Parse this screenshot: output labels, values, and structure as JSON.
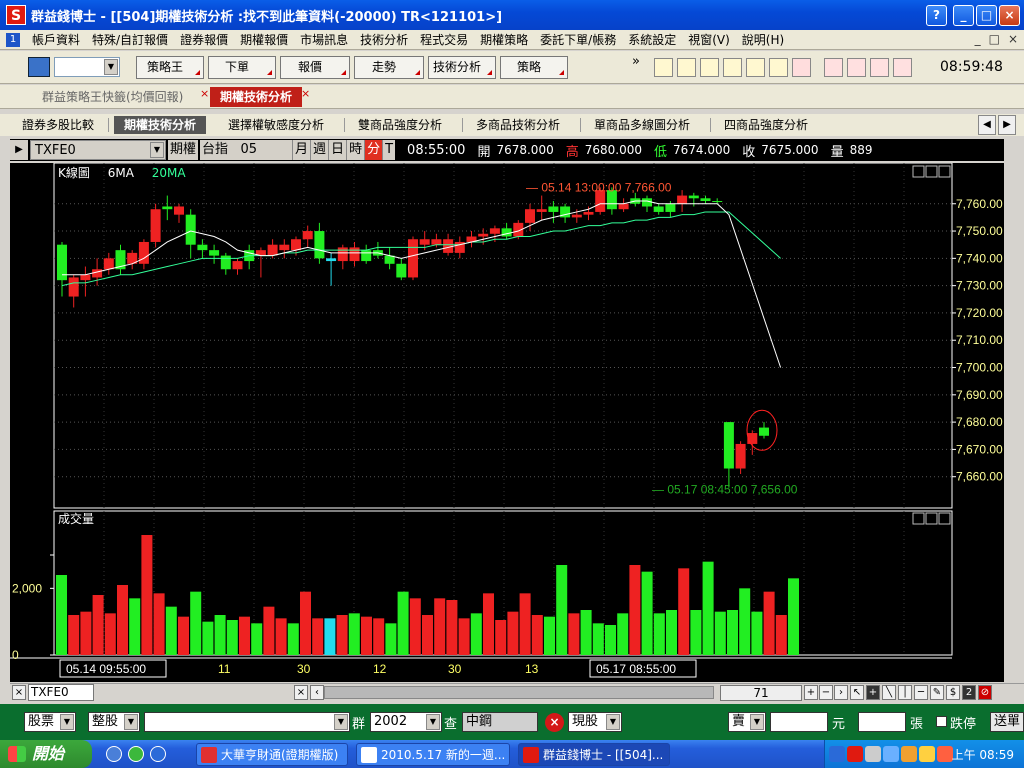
{
  "window": {
    "app_logo": "S",
    "title": "群益錢博士 - [[504]期權技術分析 :找不到此筆資料(-20000) TR<121101>]",
    "help_btn": "?",
    "min_btn": "_",
    "max_btn": "□",
    "close_btn": "×"
  },
  "menu": {
    "items": [
      "帳戶資料",
      "特殊/自訂報價",
      "證券報價",
      "期權報價",
      "市場訊息",
      "技術分析",
      "程式交易",
      "期權策略",
      "委託下單/帳務",
      "系統設定",
      "視窗(V)",
      "說明(H)"
    ],
    "mdi_controls": [
      "_",
      "□",
      "×"
    ]
  },
  "toolbar": {
    "buttons": [
      "策略王",
      "下單",
      "報價",
      "走勢",
      "技術分析",
      "策略"
    ],
    "overflow": "»",
    "clock": "08:59:48"
  },
  "tabs": {
    "items": [
      {
        "label": "群益策略王快籤(均價回報)"
      },
      {
        "label": "期權技術分析"
      }
    ],
    "close": "×"
  },
  "subtabs": {
    "items": [
      "證券多股比較",
      "期權技術分析",
      "選擇權敏感度分析",
      "雙商品強度分析",
      "多商品技術分析",
      "單商品多線圖分析",
      "四商品強度分析"
    ],
    "prev": "◀",
    "next": "▶"
  },
  "quote": {
    "play": "▶",
    "symbol": "TXFE0",
    "market": "期權",
    "product": "台指",
    "month": "05",
    "periods": [
      "月",
      "週",
      "日",
      "時",
      "分",
      "T"
    ],
    "time": "08:55:00",
    "open_label": "開",
    "open": "7678.000",
    "high_label": "高",
    "high": "7680.000",
    "low_label": "低",
    "low": "7674.000",
    "close_label": "收",
    "close": "7675.000",
    "volume_label": "量",
    "volume": "889",
    "colors": {
      "high": "#ff3333",
      "low": "#33ff33"
    }
  },
  "chart_data": [
    {
      "type": "candlestick",
      "title": "K線圖",
      "legend": [
        {
          "name": "6MA",
          "color": "#ffffff"
        },
        {
          "name": "20MA",
          "color": "#33ff99"
        }
      ],
      "ylim": [
        7650,
        7772
      ],
      "y_ticks": [
        "7,760.00",
        "7,750.00",
        "7,740.00",
        "7,730.00",
        "7,720.00",
        "7,710.00",
        "7,700.00",
        "7,690.00",
        "7,680.00",
        "7,670.00",
        "7,660.00"
      ],
      "annotation_high": "05.14 13:00:00  7,766.00",
      "annotation_low": "05.17 08:45:00  7,656.00",
      "x_ticks": [
        "05.14 09:55:00",
        "11",
        "30",
        "12",
        "30",
        "13",
        "05.17 08:55:00"
      ],
      "candles": [
        {
          "o": 7732,
          "h": 7746,
          "l": 7726,
          "c": 7745,
          "col": "g"
        },
        {
          "o": 7733,
          "h": 7734,
          "l": 7722,
          "c": 7726,
          "col": "r"
        },
        {
          "o": 7734,
          "h": 7737,
          "l": 7726,
          "c": 7732,
          "col": "r"
        },
        {
          "o": 7736,
          "h": 7740,
          "l": 7730,
          "c": 7733,
          "col": "r"
        },
        {
          "o": 7740,
          "h": 7742,
          "l": 7734,
          "c": 7736,
          "col": "r"
        },
        {
          "o": 7736,
          "h": 7745,
          "l": 7734,
          "c": 7743,
          "col": "g"
        },
        {
          "o": 7742,
          "h": 7743,
          "l": 7736,
          "c": 7738,
          "col": "r"
        },
        {
          "o": 7738,
          "h": 7747,
          "l": 7736,
          "c": 7746,
          "col": "r"
        },
        {
          "o": 7746,
          "h": 7760,
          "l": 7744,
          "c": 7758,
          "col": "r"
        },
        {
          "o": 7758,
          "h": 7763,
          "l": 7754,
          "c": 7759,
          "col": "g"
        },
        {
          "o": 7759,
          "h": 7760,
          "l": 7753,
          "c": 7756,
          "col": "r"
        },
        {
          "o": 7756,
          "h": 7758,
          "l": 7740,
          "c": 7745,
          "col": "g"
        },
        {
          "o": 7745,
          "h": 7747,
          "l": 7740,
          "c": 7743,
          "col": "g"
        },
        {
          "o": 7743,
          "h": 7745,
          "l": 7738,
          "c": 7741,
          "col": "g"
        },
        {
          "o": 7741,
          "h": 7742,
          "l": 7734,
          "c": 7736,
          "col": "g"
        },
        {
          "o": 7736,
          "h": 7740,
          "l": 7734,
          "c": 7739,
          "col": "r"
        },
        {
          "o": 7739,
          "h": 7745,
          "l": 7736,
          "c": 7743,
          "col": "g"
        },
        {
          "o": 7743,
          "h": 7744,
          "l": 7733,
          "c": 7741,
          "col": "r"
        },
        {
          "o": 7741,
          "h": 7747,
          "l": 7740,
          "c": 7745,
          "col": "r"
        },
        {
          "o": 7745,
          "h": 7747,
          "l": 7740,
          "c": 7743,
          "col": "r"
        },
        {
          "o": 7743,
          "h": 7748,
          "l": 7741,
          "c": 7747,
          "col": "r"
        },
        {
          "o": 7747,
          "h": 7752,
          "l": 7744,
          "c": 7750,
          "col": "r"
        },
        {
          "o": 7750,
          "h": 7753,
          "l": 7738,
          "c": 7740,
          "col": "g"
        },
        {
          "o": 7740,
          "h": 7742,
          "l": 7730,
          "c": 7739,
          "col": "c"
        },
        {
          "o": 7739,
          "h": 7745,
          "l": 7736,
          "c": 7744,
          "col": "r"
        },
        {
          "o": 7744,
          "h": 7746,
          "l": 7737,
          "c": 7739,
          "col": "r"
        },
        {
          "o": 7739,
          "h": 7745,
          "l": 7738,
          "c": 7743,
          "col": "g"
        },
        {
          "o": 7743,
          "h": 7746,
          "l": 7740,
          "c": 7741,
          "col": "g"
        },
        {
          "o": 7741,
          "h": 7744,
          "l": 7736,
          "c": 7738,
          "col": "g"
        },
        {
          "o": 7738,
          "h": 7740,
          "l": 7732,
          "c": 7733,
          "col": "g"
        },
        {
          "o": 7733,
          "h": 7748,
          "l": 7732,
          "c": 7747,
          "col": "r"
        },
        {
          "o": 7747,
          "h": 7750,
          "l": 7743,
          "c": 7745,
          "col": "r"
        },
        {
          "o": 7745,
          "h": 7749,
          "l": 7744,
          "c": 7747,
          "col": "r"
        },
        {
          "o": 7747,
          "h": 7749,
          "l": 7741,
          "c": 7742,
          "col": "r"
        },
        {
          "o": 7742,
          "h": 7748,
          "l": 7740,
          "c": 7746,
          "col": "r"
        },
        {
          "o": 7746,
          "h": 7750,
          "l": 7744,
          "c": 7748,
          "col": "r"
        },
        {
          "o": 7748,
          "h": 7751,
          "l": 7745,
          "c": 7749,
          "col": "r"
        },
        {
          "o": 7749,
          "h": 7752,
          "l": 7746,
          "c": 7751,
          "col": "r"
        },
        {
          "o": 7751,
          "h": 7753,
          "l": 7747,
          "c": 7748,
          "col": "g"
        },
        {
          "o": 7748,
          "h": 7754,
          "l": 7747,
          "c": 7753,
          "col": "r"
        },
        {
          "o": 7753,
          "h": 7760,
          "l": 7750,
          "c": 7758,
          "col": "r"
        },
        {
          "o": 7758,
          "h": 7763,
          "l": 7754,
          "c": 7757,
          "col": "r"
        },
        {
          "o": 7757,
          "h": 7761,
          "l": 7753,
          "c": 7759,
          "col": "g"
        },
        {
          "o": 7759,
          "h": 7760,
          "l": 7753,
          "c": 7755,
          "col": "g"
        },
        {
          "o": 7755,
          "h": 7758,
          "l": 7753,
          "c": 7756,
          "col": "r"
        },
        {
          "o": 7756,
          "h": 7759,
          "l": 7754,
          "c": 7757,
          "col": "r"
        },
        {
          "o": 7757,
          "h": 7766,
          "l": 7756,
          "c": 7765,
          "col": "r"
        },
        {
          "o": 7765,
          "h": 7766,
          "l": 7756,
          "c": 7758,
          "col": "g"
        },
        {
          "o": 7758,
          "h": 7762,
          "l": 7757,
          "c": 7760,
          "col": "r"
        },
        {
          "o": 7760,
          "h": 7764,
          "l": 7759,
          "c": 7762,
          "col": "g"
        },
        {
          "o": 7762,
          "h": 7763,
          "l": 7757,
          "c": 7759,
          "col": "g"
        },
        {
          "o": 7759,
          "h": 7760,
          "l": 7756,
          "c": 7757,
          "col": "g"
        },
        {
          "o": 7757,
          "h": 7761,
          "l": 7755,
          "c": 7760,
          "col": "g"
        },
        {
          "o": 7760,
          "h": 7765,
          "l": 7757,
          "c": 7763,
          "col": "r"
        },
        {
          "o": 7763,
          "h": 7764,
          "l": 7759,
          "c": 7762,
          "col": "g"
        },
        {
          "o": 7762,
          "h": 7763,
          "l": 7760,
          "c": 7761,
          "col": "g"
        },
        {
          "o": 7761,
          "h": 7762,
          "l": 7760,
          "c": 7761,
          "col": "g"
        },
        {
          "o": 7680,
          "h": 7680,
          "l": 7656,
          "c": 7663,
          "col": "g"
        },
        {
          "o": 7663,
          "h": 7673,
          "l": 7661,
          "c": 7672,
          "col": "r"
        },
        {
          "o": 7672,
          "h": 7677,
          "l": 7668,
          "c": 7676,
          "col": "r"
        },
        {
          "o": 7675,
          "h": 7680,
          "l": 7674,
          "c": 7678,
          "col": "g"
        }
      ],
      "ma6": [
        7734,
        7734,
        7734,
        7735,
        7736,
        7737,
        7738,
        7740,
        7743,
        7746,
        7748,
        7750,
        7749,
        7748,
        7746,
        7743,
        7742,
        7741,
        7741,
        7742,
        7743,
        7744,
        7743,
        7742,
        7742,
        7742,
        7742,
        7742,
        7741,
        7740,
        7741,
        7742,
        7743,
        7744,
        7745,
        7746,
        7747,
        7748,
        7749,
        7750,
        7752,
        7754,
        7755,
        7756,
        7757,
        7758,
        7760,
        7760,
        7760,
        7761,
        7761,
        7760,
        7760,
        7760,
        7760,
        7760,
        7760,
        7756,
        7700
      ],
      "ma20": [
        7730,
        7731,
        7731,
        7732,
        7733,
        7734,
        7734,
        7735,
        7736,
        7737,
        7738,
        7739,
        7740,
        7740,
        7740,
        7740,
        7741,
        7741,
        7741,
        7742,
        7742,
        7743,
        7743,
        7743,
        7743,
        7743,
        7743,
        7744,
        7744,
        7744,
        7744,
        7744,
        7745,
        7745,
        7745,
        7746,
        7746,
        7747,
        7747,
        7748,
        7748,
        7749,
        7750,
        7750,
        7751,
        7752,
        7752,
        7753,
        7753,
        7754,
        7754,
        7755,
        7755,
        7756,
        7756,
        7757,
        7757,
        7757,
        7740
      ]
    },
    {
      "type": "bar",
      "title": "成交量",
      "y_ticks": [
        "2,000",
        "0"
      ],
      "ylim": [
        0,
        4200
      ],
      "values": [
        2400,
        1200,
        1300,
        1800,
        1250,
        2100,
        1700,
        3600,
        1850,
        1450,
        1150,
        1900,
        1000,
        1200,
        1050,
        1150,
        950,
        1450,
        1100,
        950,
        1900,
        1100,
        1100,
        1200,
        1250,
        1150,
        1100,
        950,
        1900,
        1700,
        1200,
        1700,
        1650,
        1100,
        1250,
        1850,
        1050,
        1300,
        1850,
        1200,
        1150,
        2700,
        1250,
        1350,
        950,
        900,
        1250,
        2700,
        2500,
        1250,
        1350,
        2600,
        1350,
        2800,
        1300,
        1350,
        2000,
        1300,
        1900,
        1200,
        2300
      ],
      "colors_per_bar": [
        "g",
        "r",
        "r",
        "r",
        "r",
        "r",
        "g",
        "r",
        "r",
        "g",
        "r",
        "g",
        "g",
        "g",
        "g",
        "r",
        "g",
        "r",
        "r",
        "g",
        "r",
        "r",
        "c",
        "r",
        "g",
        "r",
        "r",
        "g",
        "g",
        "r",
        "r",
        "r",
        "r",
        "r",
        "g",
        "r",
        "r",
        "r",
        "r",
        "r",
        "g",
        "g",
        "r",
        "g",
        "g",
        "g",
        "g",
        "r",
        "g",
        "g",
        "g",
        "r",
        "g",
        "g",
        "g",
        "g",
        "g",
        "g",
        "r",
        "r",
        "g"
      ]
    }
  ],
  "bottombar": {
    "sheet_tab": "TXFE0",
    "bar_count": "71"
  },
  "orderbar": {
    "asset": "股票",
    "board": "整股",
    "group_label": "群",
    "stock_code": "2002",
    "query_label": "查",
    "stock_name": "中鋼",
    "cancel": "×",
    "trade_type": "現股",
    "side": "賣",
    "price_unit": "元",
    "qty_unit": "張",
    "stop_label": "跌停",
    "send_label": "送單"
  },
  "taskbar": {
    "start": "開始",
    "tasks": [
      "大華亨財通(證期權版)",
      "2010.5.17 新的一週...",
      "群益錢博士 - [[504]..."
    ],
    "time": "上午 08:59"
  }
}
